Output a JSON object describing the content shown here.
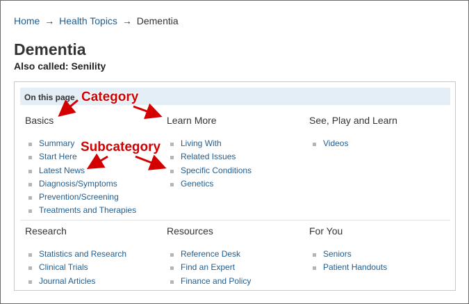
{
  "breadcrumb": {
    "items": [
      "Home",
      "Health Topics"
    ],
    "separator": "→",
    "current": "Dementia"
  },
  "title": "Dementia",
  "also_called": "Also called: Senility",
  "on_this_page": {
    "header": "On this page",
    "sections": [
      {
        "title": "Basics",
        "links": [
          "Summary",
          "Start Here",
          "Latest News",
          "Diagnosis/Symptoms",
          "Prevention/Screening",
          "Treatments and Therapies"
        ]
      },
      {
        "title": "Learn More",
        "links": [
          "Living With",
          "Related Issues",
          "Specific Conditions",
          "Genetics"
        ]
      },
      {
        "title": "See, Play and Learn",
        "links": [
          "Videos"
        ]
      },
      {
        "title": "Research",
        "links": [
          "Statistics and Research",
          "Clinical Trials",
          "Journal Articles"
        ]
      },
      {
        "title": "Resources",
        "links": [
          "Reference Desk",
          "Find an Expert",
          "Finance and Policy"
        ]
      },
      {
        "title": "For You",
        "links": [
          "Seniors",
          "Patient Handouts"
        ]
      }
    ]
  },
  "annotations": {
    "category": "Category",
    "subcategory": "Subcategory",
    "color": "#d40000"
  },
  "colors": {
    "link": "#1f5d8f",
    "header_bg": "#e4eef7",
    "bullet": "#b5b5b5"
  }
}
